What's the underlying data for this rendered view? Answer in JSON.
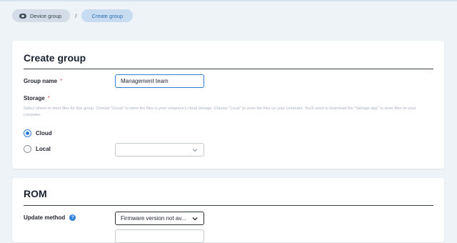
{
  "breadcrumb": {
    "items": [
      {
        "label": "Device group",
        "icon": "device-group-icon"
      },
      {
        "label": "Create group"
      }
    ],
    "separator": "/"
  },
  "create_group": {
    "title": "Create group",
    "group_name": {
      "label": "Group name",
      "required_mark": "*",
      "value": "Management team"
    },
    "storage": {
      "label": "Storage",
      "required_mark": "*",
      "hint": "Select where to store files for this group. Choose \"Cloud\" to store the files in your company's cloud storage. Choose \"Local\" to store the files on your computer. You'll need to download the \"Storage app\" to store files on your computer.",
      "options": [
        {
          "label": "Cloud",
          "checked": true
        },
        {
          "label": "Local",
          "checked": false
        }
      ],
      "local_select_value": ""
    }
  },
  "rom": {
    "title": "ROM",
    "update_method": {
      "label": "Update method",
      "help_icon": "help-icon",
      "value": "Firmware version not av..."
    }
  },
  "colors": {
    "accent": "#2f7ed8",
    "background": "#eef3f8",
    "required": "#d9534f"
  }
}
